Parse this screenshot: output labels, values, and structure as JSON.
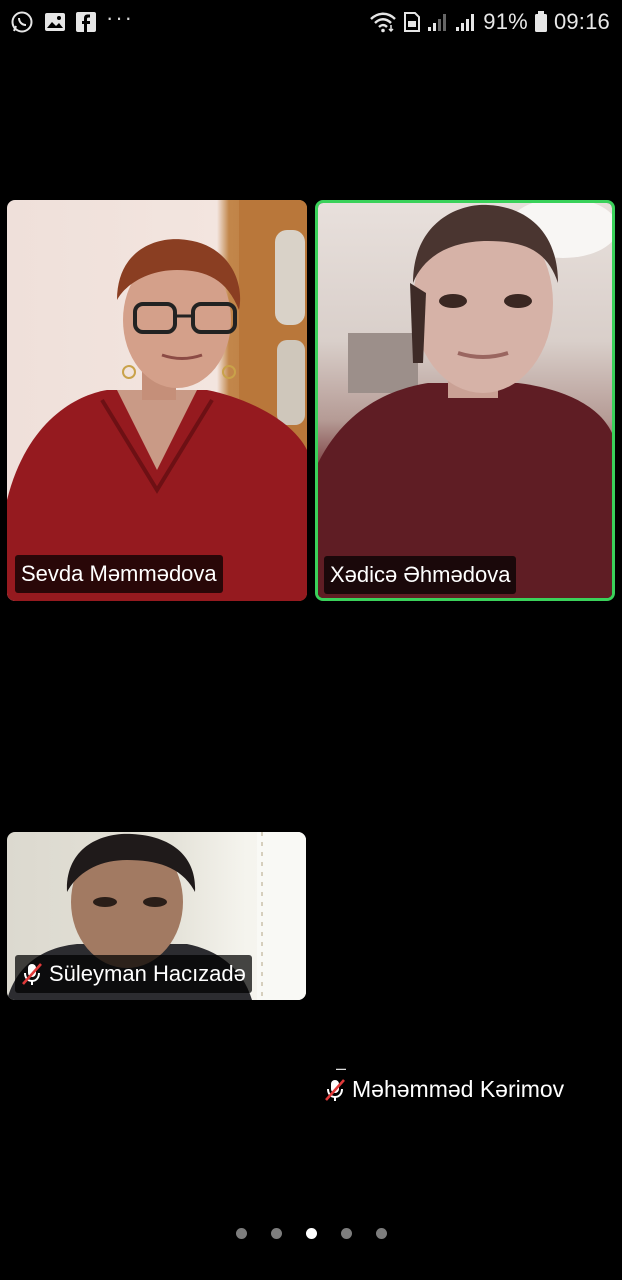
{
  "status_bar": {
    "left_icons": [
      "whatsapp-icon",
      "gallery-icon",
      "facebook-icon",
      "more-notifications-icon"
    ],
    "more_label": "···",
    "battery_percent": "91%",
    "time": "09:16"
  },
  "participants": [
    {
      "name": "Sevda Məmmədova",
      "muted": false,
      "active_speaker": false,
      "video": true
    },
    {
      "name": "Xədicə Əhmədova",
      "muted": false,
      "active_speaker": true,
      "video": true
    },
    {
      "name": "Süleyman Hacızadə",
      "muted": true,
      "active_speaker": false,
      "video": true
    },
    {
      "name": "Məhəmməd Kərimov",
      "muted": true,
      "active_speaker": false,
      "video": false,
      "dash": "–"
    }
  ],
  "pagination": {
    "total_pages": 5,
    "current_page": 3
  },
  "colors": {
    "active_speaker_border": "#3ad15a",
    "background": "#000000",
    "muted_icon": "#e03a3a"
  }
}
